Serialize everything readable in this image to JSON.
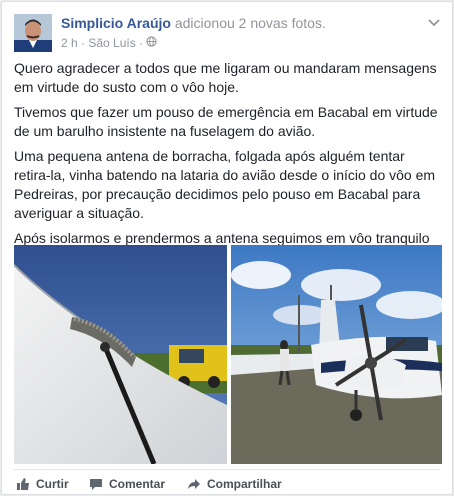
{
  "post": {
    "author": "Simplicio Araújo",
    "action": "adicionou 2 novas fotos.",
    "time": "2 h",
    "separator": "·",
    "location": "São Luís",
    "privacy_icon": "globe-icon",
    "paragraphs": [
      "Quero agradecer a todos que me ligaram ou mandaram mensagens em virtude do susto com o vôo hoje.",
      "Tivemos que fazer um pouso de emergência em Bacabal em virtude de um barulho insistente na fuselagem do avião.",
      "Uma pequena antena de borracha, folgada após alguém tentar retira-la, vinha batendo na lataria do avião desde o início do vôo em Pedreiras, por precaução decidimos pelo pouso em Bacabal para averiguar a situação.",
      "Após isolarmos e prendermos a antena seguimos em vôo tranquilo até São Luís."
    ]
  },
  "actions": {
    "like": "Curtir",
    "comment": "Comentar",
    "share": "Compartilhar"
  },
  "colors": {
    "link": "#365899",
    "muted": "#90949c",
    "text": "#1d2129"
  }
}
